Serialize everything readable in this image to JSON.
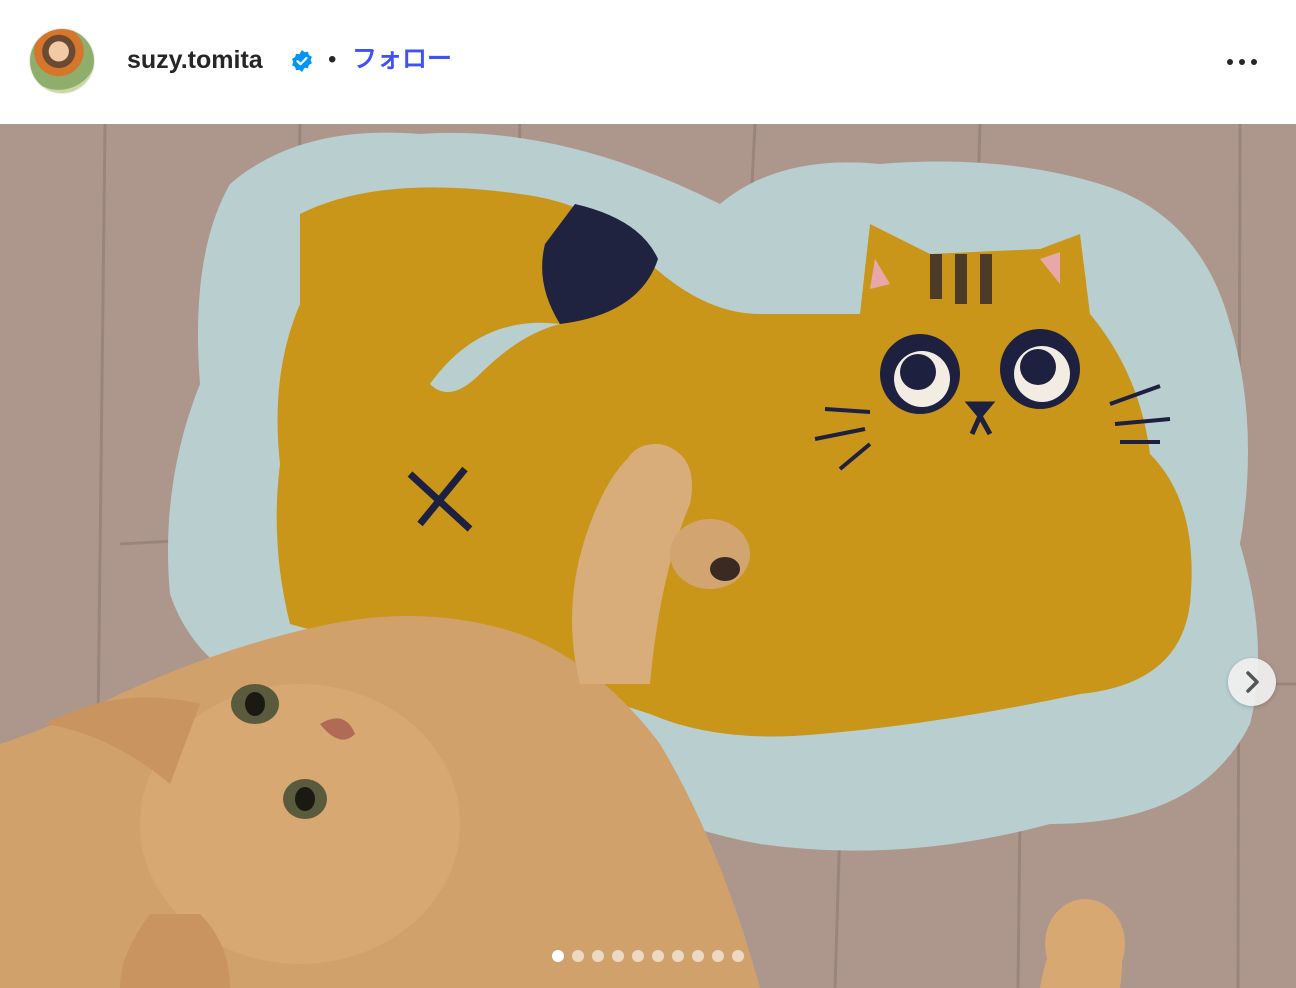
{
  "post": {
    "username": "suzy.tomita",
    "separator": "•",
    "follow_label": "フォロー",
    "more_icon": "more-horizontal-icon",
    "verified_icon": "verified-badge-icon"
  },
  "media": {
    "description_icon": "photo",
    "carousel_count": 10,
    "active_index": 0,
    "next_icon": "chevron-right-icon"
  },
  "colors": {
    "follow_blue": "#4150f7",
    "verified_blue": "#0095f6",
    "text": "#262626"
  }
}
